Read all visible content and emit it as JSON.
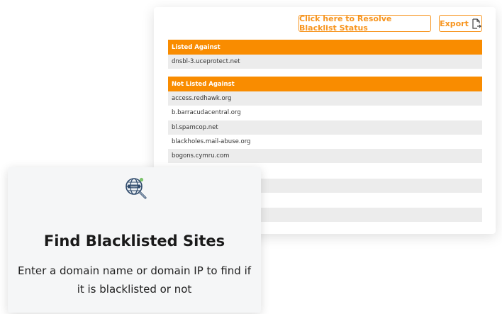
{
  "blacklist_panel": {
    "resolve_button_label": "Click here to Resolve Blacklist Status",
    "export_button_label": "Export",
    "export_icon": "file-export-icon",
    "listed_header": "Listed Against",
    "listed_items": [
      "dnsbl-3.uceprotect.net"
    ],
    "not_listed_header": "Not Listed Against",
    "not_listed_items": [
      "access.redhawk.org",
      "b.barracudacentral.org",
      "bl.spamcop.net",
      "blackholes.mail-abuse.org",
      "bogons.cymru.com"
    ]
  },
  "info_card": {
    "icon": "web-search-icon",
    "title": "Find Blacklisted Sites",
    "description": "Enter a domain name or domain IP to find if it is blacklisted or not"
  },
  "colors": {
    "accent": "#f98c00",
    "row_shade": "#ececec",
    "card_background": "#f5f6f7"
  }
}
